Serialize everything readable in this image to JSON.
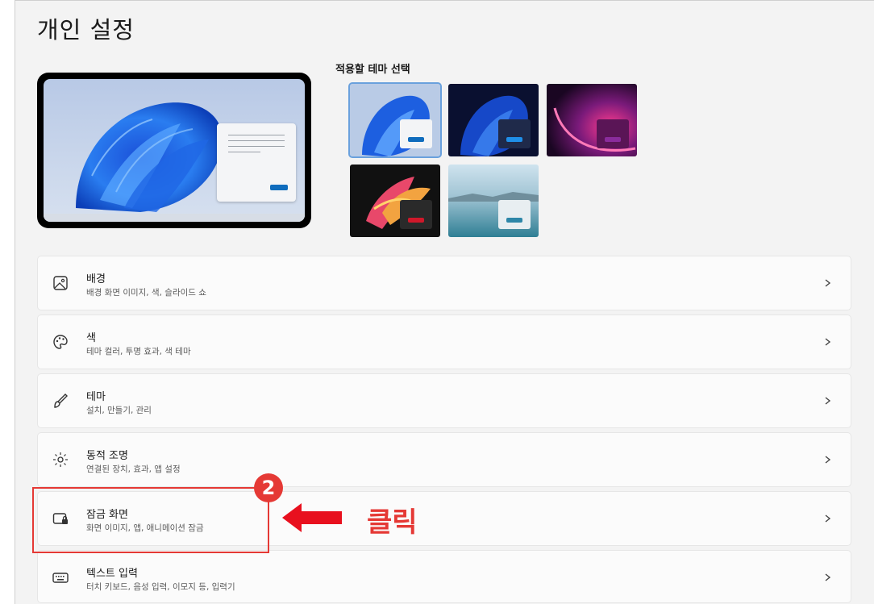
{
  "page": {
    "title": "개인 설정"
  },
  "themes": {
    "heading": "적용할 테마 선택",
    "items": [
      {
        "name": "windows-light",
        "selected": true
      },
      {
        "name": "windows-dark",
        "selected": false
      },
      {
        "name": "glow",
        "selected": false
      },
      {
        "name": "captured-motion",
        "selected": false
      },
      {
        "name": "flow",
        "selected": false
      }
    ]
  },
  "settings": [
    {
      "id": "background",
      "title": "배경",
      "subtitle": "배경 화면 이미지, 색, 슬라이드 쇼",
      "icon": "image-icon"
    },
    {
      "id": "colors",
      "title": "색",
      "subtitle": "테마 컬러, 투명 효과, 색 테마",
      "icon": "palette-icon"
    },
    {
      "id": "themes",
      "title": "테마",
      "subtitle": "설치, 만들기, 관리",
      "icon": "brush-icon"
    },
    {
      "id": "dynamic-lighting",
      "title": "동적 조명",
      "subtitle": "연결된 장치, 효과, 앱 설정",
      "icon": "lighting-icon"
    },
    {
      "id": "lock-screen",
      "title": "잠금 화면",
      "subtitle": "화면 이미지, 앱, 애니메이션 잠금",
      "icon": "lock-screen-icon"
    },
    {
      "id": "text-input",
      "title": "텍스트 입력",
      "subtitle": "터치 키보드, 음성 입력, 이모지 등, 입력기",
      "icon": "keyboard-icon"
    }
  ],
  "annotation": {
    "step": "2",
    "label": "클릭",
    "color": "#e53935"
  }
}
